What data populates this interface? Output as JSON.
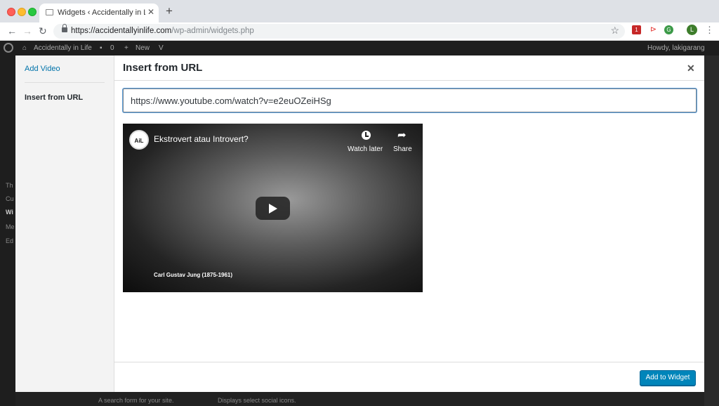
{
  "browser": {
    "tab_title": "Widgets ‹ Accidentally in Life —",
    "url_host": "https://accidentallyinlife.com",
    "url_path": "/wp-admin/widgets.php",
    "ext_badge": "1",
    "profile_initial": "L"
  },
  "adminbar": {
    "site_name": "Accidentally in Life",
    "comments_count": "0",
    "new_label": "New",
    "greeting": "Howdy, lakigarang"
  },
  "background": {
    "sidebar_items": [
      "Th",
      "Cu",
      "Wi",
      "Me",
      "Ed"
    ],
    "bottom_left": "A search form for your site.",
    "bottom_right": "Displays select social icons."
  },
  "modal": {
    "menu_add_video": "Add Video",
    "menu_insert_url": "Insert from URL",
    "title": "Insert from URL",
    "url_value": "https://www.youtube.com/watch?v=e2euOZeiHSg",
    "button_label": "Add to Widget"
  },
  "video": {
    "channel_badge": "AiL",
    "title": "Ekstrovert atau Introvert?",
    "watch_later": "Watch later",
    "share": "Share",
    "caption": "Carl Gustav Jung (1875-1961)"
  }
}
